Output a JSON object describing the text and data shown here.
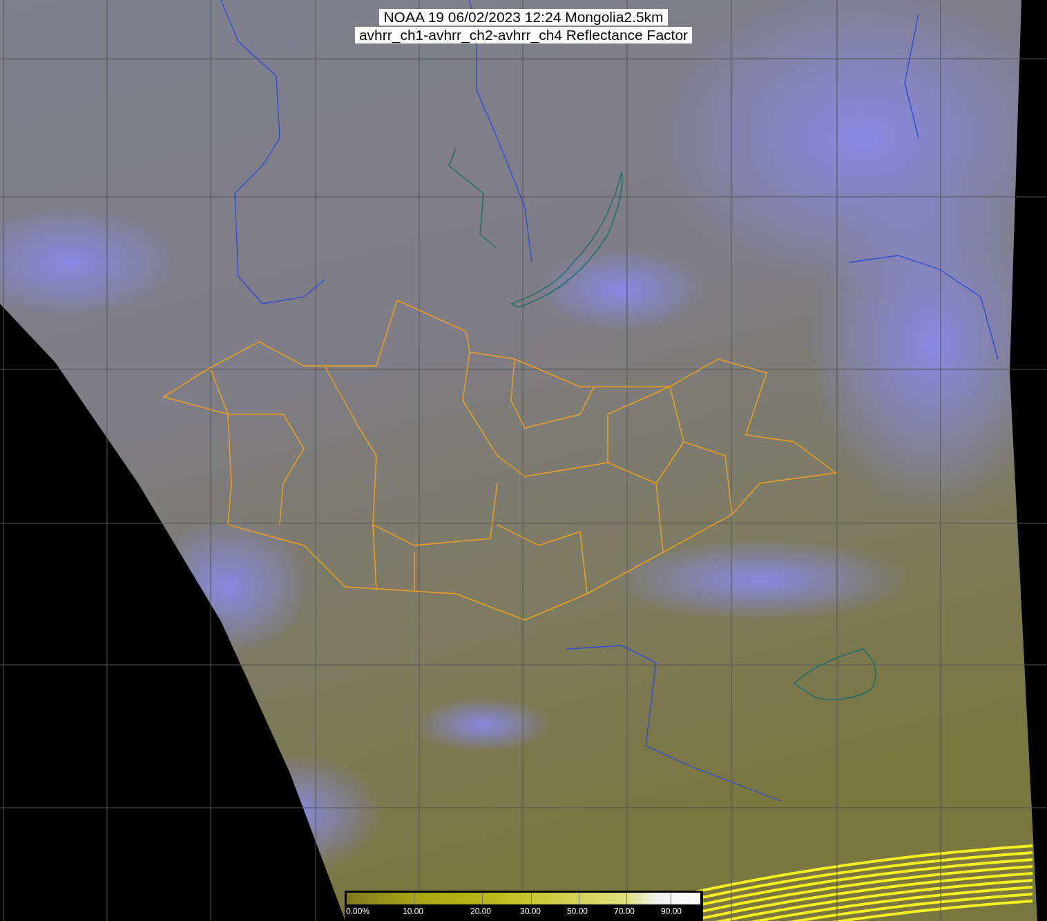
{
  "map": {
    "title_lines": [
      "NOAA 19 06/02/2023 12:24 Mongolia2.5km",
      "avhrr_ch1-avhrr_ch2-avhrr_ch4 Reflectance Factor"
    ]
  },
  "colorbar": {
    "tick_labels": [
      "0.00%",
      "10.00",
      "20.00",
      "30.00",
      "50.00",
      "70.00",
      "90.00"
    ]
  }
}
